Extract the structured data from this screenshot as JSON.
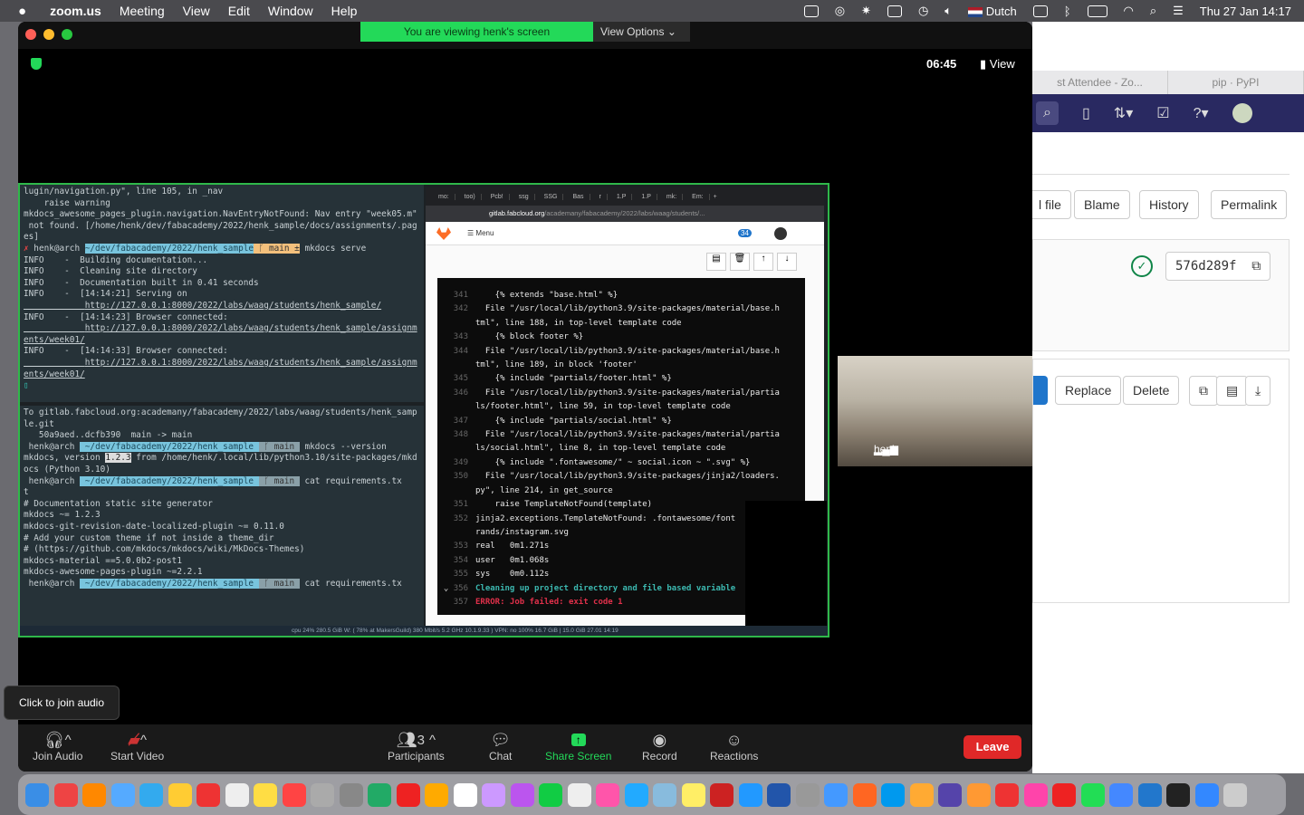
{
  "menubar": {
    "app": "zoom.us",
    "items": [
      "Meeting",
      "View",
      "Edit",
      "Window",
      "Help"
    ],
    "language": "Dutch",
    "datetime": "Thu 27 Jan  14:17"
  },
  "bg_browser": {
    "tabs": [
      "st Attendee - Zo...",
      "pip · PyPI"
    ],
    "buttons": {
      "edit": "l file",
      "blame": "Blame",
      "history": "History",
      "permalink": "Permalink",
      "replace": "Replace",
      "delete": "Delete"
    },
    "commit": "576d289f",
    "nav_color": "#292961"
  },
  "zoom": {
    "banner": "You are viewing henk's screen",
    "view_options": "View Options",
    "timer": "06:45",
    "view": "View",
    "participant": "henk",
    "tooltip": "Click to join audio",
    "toolbar": {
      "join_audio": "Join Audio",
      "start_video": "Start Video",
      "participants": "Participants",
      "participants_count": "3",
      "chat": "Chat",
      "share_screen": "Share Screen",
      "record": "Record",
      "reactions": "Reactions",
      "leave": "Leave"
    }
  },
  "terminal_top": [
    "lugin/navigation.py\", line 105, in _nav",
    "    raise warning",
    "mkdocs_awesome_pages_plugin.navigation.NavEntryNotFound: Nav entry \"week05.m\"",
    " not found. [/home/henk/dev/fabacademy/2022/henk_sample/docs/assignments/.pag",
    "es]"
  ],
  "prompt": {
    "user": "henk@arch",
    "path": "~/dev/fabacademy/2022/henk_sample",
    "branch": "main ±",
    "branch2": "main",
    "cmd1": "mkdocs serve",
    "cmd2": "mkdocs --version",
    "cmd3": "cat requirements.tx",
    "cmd3b": "t",
    "cmd4": "cat requirements.tx"
  },
  "terminal_info": [
    "INFO    -  Building documentation...",
    "INFO    -  Cleaning site directory",
    "INFO    -  Documentation built in 0.41 seconds",
    "INFO    -  [14:14:21] Serving on",
    "INFO    -  [14:14:23] Browser connected:",
    "INFO    -  [14:14:33] Browser connected:"
  ],
  "links": [
    "http://127.0.0.1:8000/2022/labs/waag/students/henk_sample/",
    "http://127.0.0.1:8000/2022/labs/waag/students/henk_sample/assignm",
    "ents/week01/"
  ],
  "terminal_bottom": {
    "push": [
      "To gitlab.fabcloud.org:academany/fabacademy/2022/labs/waag/students/henk_samp",
      "le.git",
      "   50a9aed..dcfb390  main -> main"
    ],
    "version_pre": "mkdocs, version ",
    "version": "1.2.3",
    "version_post": " from /home/henk/.local/lib/python3.10/site-packages/mkd",
    "version_line2": "ocs (Python 3.10)",
    "req": [
      "# Documentation static site generator",
      "mkdocs ~= 1.2.3",
      "mkdocs-git-revision-date-localized-plugin ~= 0.11.0",
      "",
      "# Add your custom theme if not inside a theme_dir",
      "# (https://github.com/mkdocs/mkdocs/wiki/MkDocs-Themes)",
      "mkdocs-material ==5.0.0b2-post1",
      "mkdocs-awesome-pages-plugin ~=2.2.1"
    ]
  },
  "shared_browser": {
    "tabs": [
      "mo:",
      "too)",
      "Pcb!",
      "ssg",
      "SSG",
      "Bas",
      "r",
      "1.P",
      "1.P",
      "mk:",
      "Em:"
    ],
    "url_host": "gitlab.fabcloud.org",
    "url_path": "/academany/fabacademy/2022/labs/waag/students/...",
    "menu": "Menu",
    "todo_count": "34",
    "log": [
      {
        "n": "341",
        "t": "    {% extends \"base.html\" %}"
      },
      {
        "n": "342",
        "t": "  File \"/usr/local/lib/python3.9/site-packages/material/base.h"
      },
      {
        "n": "",
        "t": "tml\", line 188, in top-level template code"
      },
      {
        "n": "343",
        "t": "    {% block footer %}"
      },
      {
        "n": "344",
        "t": "  File \"/usr/local/lib/python3.9/site-packages/material/base.h"
      },
      {
        "n": "",
        "t": "tml\", line 189, in block 'footer'"
      },
      {
        "n": "345",
        "t": "    {% include \"partials/footer.html\" %}"
      },
      {
        "n": "346",
        "t": "  File \"/usr/local/lib/python3.9/site-packages/material/partia"
      },
      {
        "n": "",
        "t": "ls/footer.html\", line 59, in top-level template code"
      },
      {
        "n": "347",
        "t": "    {% include \"partials/social.html\" %}"
      },
      {
        "n": "348",
        "t": "  File \"/usr/local/lib/python3.9/site-packages/material/partia"
      },
      {
        "n": "",
        "t": "ls/social.html\", line 8, in top-level template code"
      },
      {
        "n": "349",
        "t": "    {% include \".fontawesome/\" ~ social.icon ~ \".svg\" %}"
      },
      {
        "n": "350",
        "t": "  File \"/usr/local/lib/python3.9/site-packages/jinja2/loaders."
      },
      {
        "n": "",
        "t": "py\", line 214, in get_source"
      },
      {
        "n": "351",
        "t": "    raise TemplateNotFound(template)"
      },
      {
        "n": "352",
        "t": "jinja2.exceptions.TemplateNotFound: .fontawesome/font"
      },
      {
        "n": "",
        "t": "rands/instagram.svg"
      },
      {
        "n": "353",
        "t": "real   0m1.271s"
      },
      {
        "n": "354",
        "t": "user   0m1.068s"
      },
      {
        "n": "355",
        "t": "sys    0m0.112s"
      }
    ],
    "cleanup": {
      "n": "356",
      "t": "Cleaning up project directory and file based variable"
    },
    "error": {
      "n": "357",
      "t": "ERROR: Job failed: exit code 1"
    }
  },
  "statusbar": "cpu 24%   280.5 GiB  W: ( 78% at MakersGuild) 380 Mbit/s 5.2 GHz 10.1.9.33 ) VPN: no    100%  16.7 GiB | 15.0 GiB   27.01 14:19"
}
